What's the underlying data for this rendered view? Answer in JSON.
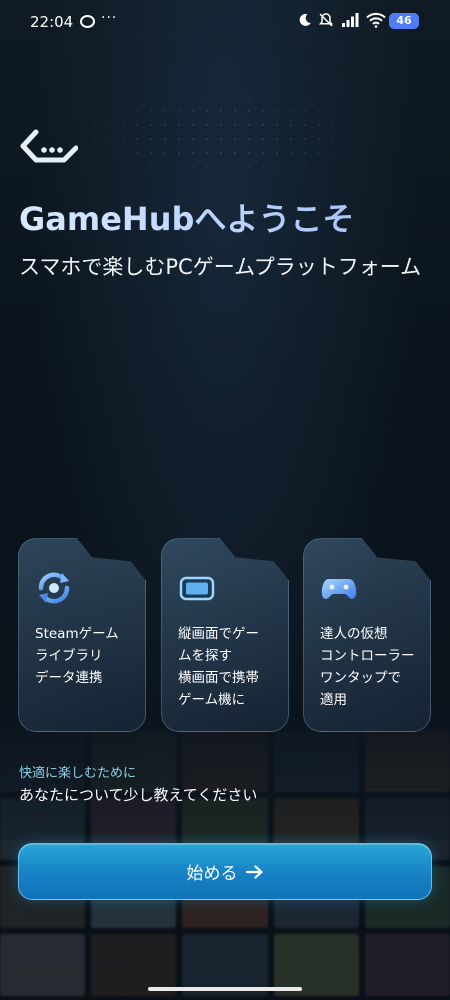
{
  "status_bar": {
    "time": "22:04",
    "more": "···",
    "battery": "46"
  },
  "header": {
    "logo_icon": "gamehub-logo-icon",
    "title": "GameHubへようこそ",
    "subtitle": "スマホで楽しむPCゲームプラットフォーム"
  },
  "features": [
    {
      "icon": "sync-icon",
      "text": "Steamゲーム\nライブラリ\nデータ連携"
    },
    {
      "icon": "phone-landscape-icon",
      "text": "縦画面でゲー\nムを探す\n横画面で携帯\nゲーム機に"
    },
    {
      "icon": "gamepad-icon",
      "text": "達人の仮想\nコントローラー\nワンタップで\n適用"
    }
  ],
  "intro": {
    "label": "快適に楽しむために",
    "text": "あなたについて少し教えてください"
  },
  "start_button": {
    "label": "始める"
  },
  "colors": {
    "accent": "#1a8fd0",
    "background": "#0b141d",
    "intro_label": "#8fd1e8"
  }
}
